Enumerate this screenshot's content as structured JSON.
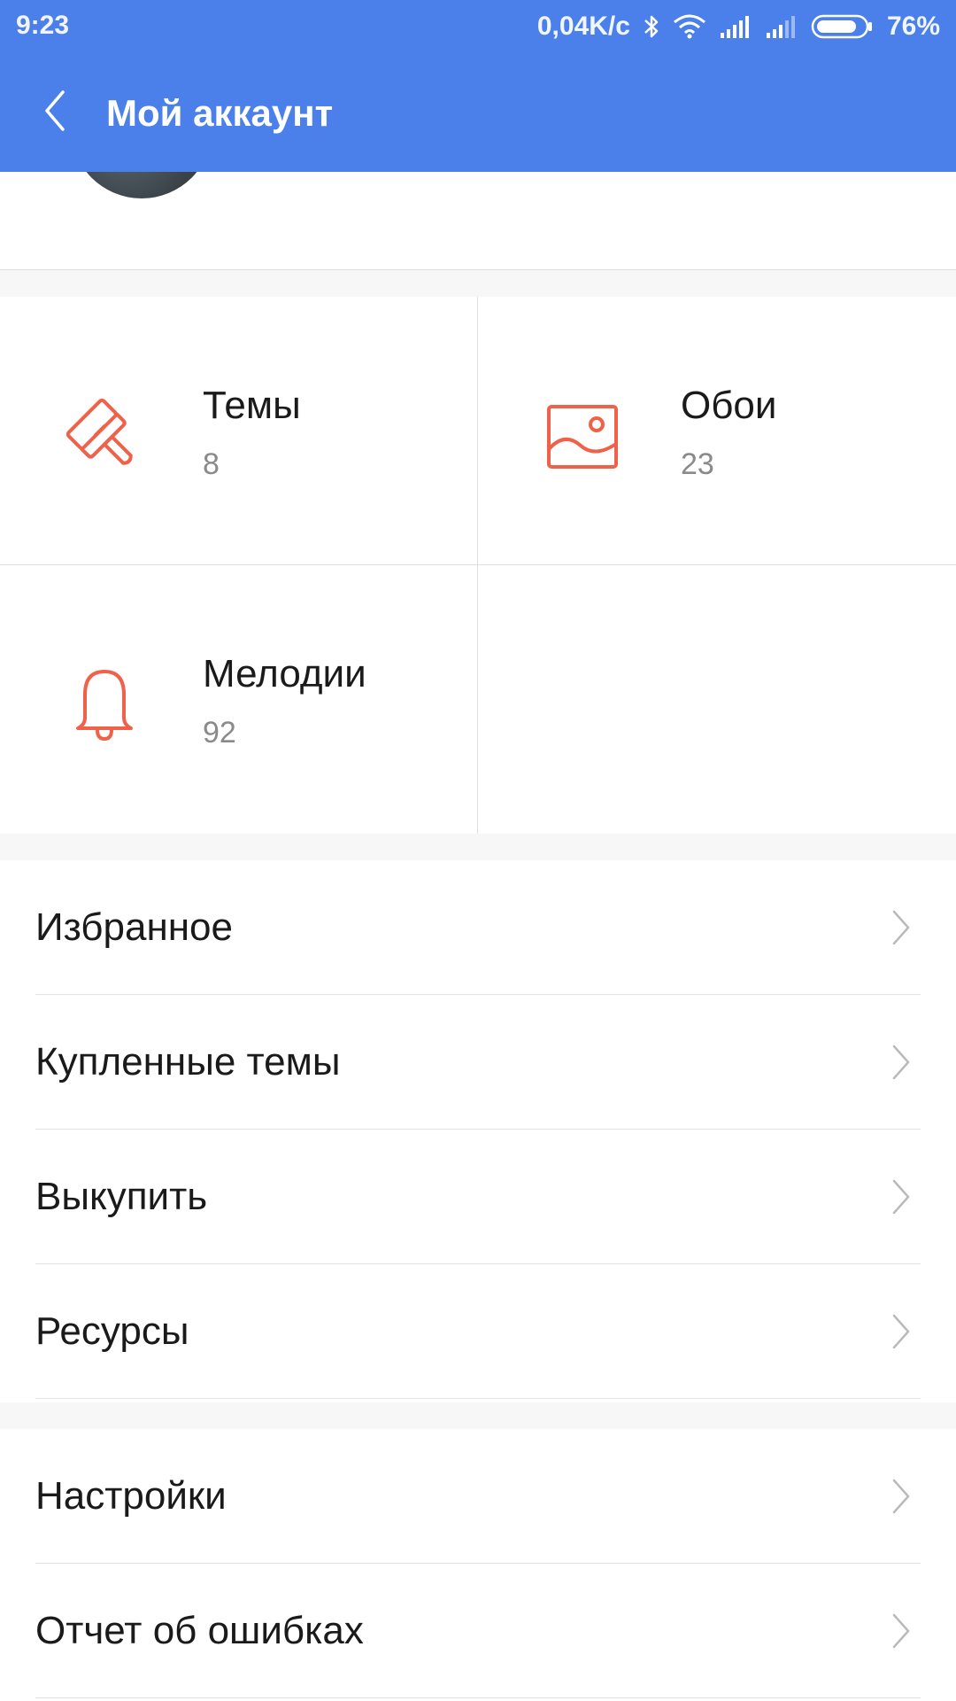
{
  "status_bar": {
    "time": "9:23",
    "net_speed": "0,04K/c",
    "battery": "76%",
    "icons": [
      "bluetooth-icon",
      "wifi-icon",
      "signal-icon",
      "signal-icon-2",
      "battery-icon"
    ]
  },
  "app_bar": {
    "title": "Мой аккаунт",
    "back_icon": "chevron-left-icon",
    "color": "#4b80ea"
  },
  "accent_color": "#f0614a",
  "grid": [
    {
      "label": "Темы",
      "count": "8",
      "icon": "brush-icon"
    },
    {
      "label": "Обои",
      "count": "23",
      "icon": "image-icon"
    },
    {
      "label": "Мелодии",
      "count": "92",
      "icon": "bell-icon"
    }
  ],
  "menu_group_1": [
    {
      "label": "Избранное"
    },
    {
      "label": "Купленные темы"
    },
    {
      "label": "Выкупить"
    },
    {
      "label": "Ресурсы"
    }
  ],
  "menu_group_2": [
    {
      "label": "Настройки"
    },
    {
      "label": "Отчет об ошибках"
    }
  ]
}
